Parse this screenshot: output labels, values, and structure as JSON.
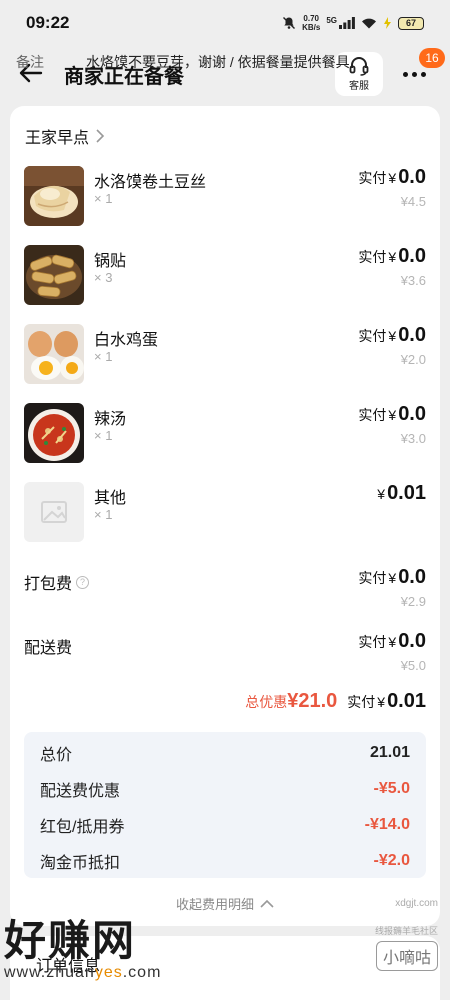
{
  "status": {
    "time": "09:22",
    "net_speed_value": "0.70",
    "net_speed_unit": "KB/s",
    "battery": "67",
    "network": "5G"
  },
  "header": {
    "title": "商家正在备餐",
    "service_label": "客服",
    "badge": "16"
  },
  "store": {
    "name": "王家早点"
  },
  "items": [
    {
      "name": "水洛馍卷土豆丝",
      "qty": "× 1",
      "paid_label": "实付",
      "yen": "¥",
      "paid": "0.0",
      "original": "¥4.5",
      "image": "flatbread"
    },
    {
      "name": "锅贴",
      "qty": "× 3",
      "paid_label": "实付",
      "yen": "¥",
      "paid": "0.0",
      "original": "¥3.6",
      "image": "potstickers"
    },
    {
      "name": "白水鸡蛋",
      "qty": "× 1",
      "paid_label": "实付",
      "yen": "¥",
      "paid": "0.0",
      "original": "¥2.0",
      "image": "eggs"
    },
    {
      "name": "辣汤",
      "qty": "× 1",
      "paid_label": "实付",
      "yen": "¥",
      "paid": "0.0",
      "original": "¥3.0",
      "image": "spicy-soup"
    },
    {
      "name": "其他",
      "qty": "× 1",
      "paid_label": "",
      "yen": "¥",
      "paid": "0.01",
      "original": "",
      "image": "placeholder"
    }
  ],
  "fees": [
    {
      "name": "打包费",
      "paid_label": "实付",
      "yen": "¥",
      "paid": "0.0",
      "original": "¥2.9",
      "has_help": true
    },
    {
      "name": "配送费",
      "paid_label": "实付",
      "yen": "¥",
      "paid": "0.0",
      "original": "¥5.0",
      "has_help": false
    }
  ],
  "totals": {
    "discount_label": "总优惠",
    "discount_value": "¥21.0",
    "paid_label": "实付",
    "yen": "¥",
    "paid_value": "0.01"
  },
  "summary": [
    {
      "label": "总价",
      "value": "21.01",
      "red": false
    },
    {
      "label": "配送费优惠",
      "value": "-¥5.0",
      "red": true
    },
    {
      "label": "红包/抵用券",
      "value": "-¥14.0",
      "red": true
    },
    {
      "label": "淘金币抵扣",
      "value": "-¥2.0",
      "red": true
    }
  ],
  "collapse_label": "收起费用明细",
  "order_info": {
    "title": "订单信息",
    "remark_label": "备注",
    "remark_text": "水烙馍不要豆芽，谢谢 / 依据餐量提供餐具"
  },
  "watermark": {
    "title": "好赚网",
    "url_pre": "www.zhuan",
    "url_hl": "yes",
    "url_post": ".com",
    "right_top": "线报薅羊毛社区",
    "right_box": "小嘀咕",
    "right_url": "xdgjt.com"
  },
  "colors": {
    "accent_red": "#e9573f",
    "badge_orange": "#ff6a1a",
    "summary_bg": "#f1f4f9"
  }
}
